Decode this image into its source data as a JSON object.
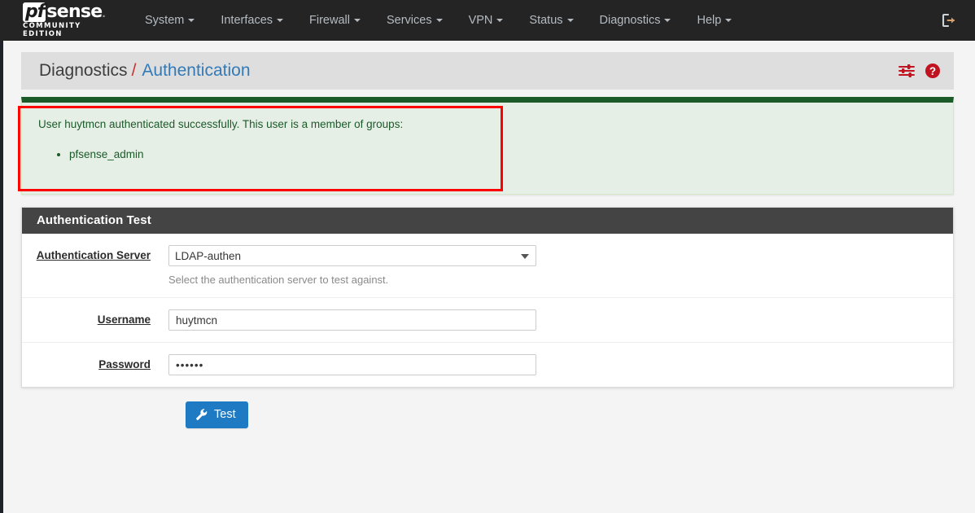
{
  "brand": {
    "name_pf": "pf",
    "name_sense": "sense",
    "trademark": ".",
    "subtitle": "COMMUNITY EDITION"
  },
  "navbar": {
    "items": [
      {
        "label": "System",
        "has_caret": true
      },
      {
        "label": "Interfaces",
        "has_caret": true
      },
      {
        "label": "Firewall",
        "has_caret": true
      },
      {
        "label": "Services",
        "has_caret": true
      },
      {
        "label": "VPN",
        "has_caret": true
      },
      {
        "label": "Status",
        "has_caret": true
      },
      {
        "label": "Diagnostics",
        "has_caret": true
      },
      {
        "label": "Help",
        "has_caret": true
      }
    ],
    "logout_icon": "sign-out-icon",
    "background_color": "#242424",
    "link_color": "#b4bcc2"
  },
  "page_header": {
    "breadcrumb_parent": "Diagnostics",
    "breadcrumb_separator": "/",
    "breadcrumb_current": "Authentication",
    "icons": [
      {
        "name": "sliders-icon",
        "color": "#c1121f"
      },
      {
        "name": "help-circle-icon",
        "color": "#c1121f"
      }
    ],
    "separator_color": "#c9302c",
    "link_color": "#337ab7"
  },
  "alert": {
    "type": "success",
    "message": "User huytmcn authenticated successfully. This user is a member of groups:",
    "groups": [
      "pfsense_admin"
    ],
    "background_color": "#e6efe6",
    "top_border_color": "#1c5a2a",
    "text_color": "#1c5a2a"
  },
  "annotation": {
    "shape": "rectangle",
    "color": "#ff0000",
    "target": "authentication-success-alert"
  },
  "panel": {
    "title": "Authentication Test",
    "header_background": "#444444",
    "rows": [
      {
        "label": "Authentication Server",
        "field_type": "select",
        "value": "LDAP-authen",
        "options": [
          "LDAP-authen"
        ],
        "help": "Select the authentication server to test against."
      },
      {
        "label": "Username",
        "field_type": "text",
        "value": "huytmcn",
        "placeholder": ""
      },
      {
        "label": "Password",
        "field_type": "password",
        "value": "••••••",
        "masked_length": 6,
        "placeholder": ""
      }
    ]
  },
  "submit": {
    "label": "Test",
    "icon": "wrench-icon",
    "color": "#1f7ac4"
  }
}
